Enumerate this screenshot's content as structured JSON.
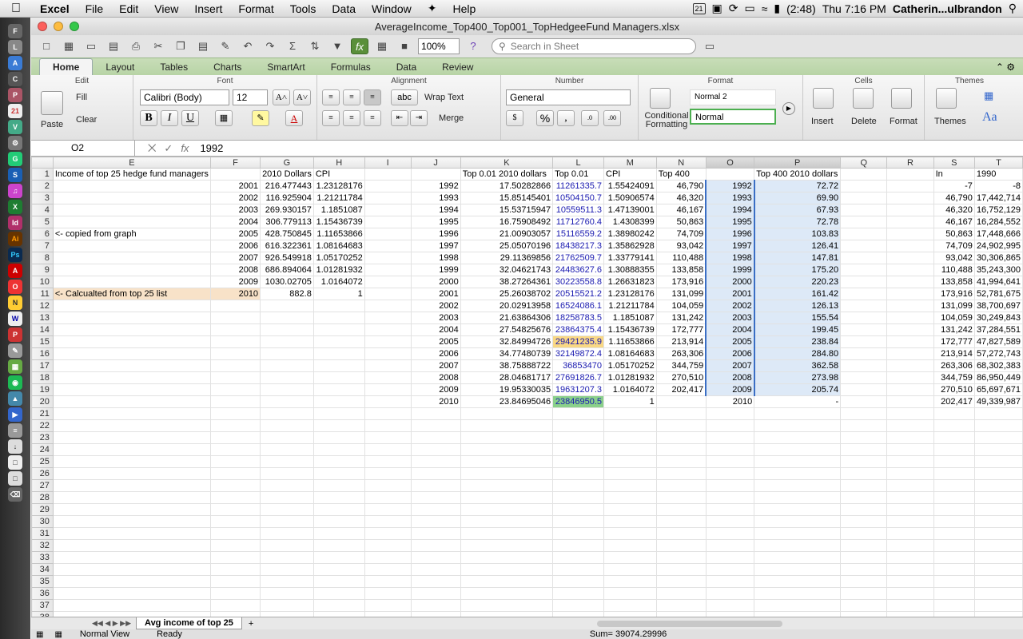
{
  "menubar": {
    "app": "Excel",
    "items": [
      "File",
      "Edit",
      "View",
      "Insert",
      "Format",
      "Tools",
      "Data",
      "Window",
      "Help"
    ],
    "battery": "(2:48)",
    "clock": "Thu 7:16 PM",
    "user": "Catherin...ulbrandon",
    "calendar_day": "21"
  },
  "window": {
    "title": "AverageIncome_Top400_Top001_TopHedgeeFund Managers.xlsx",
    "zoom": "100%",
    "search_placeholder": "Search in Sheet"
  },
  "ribbon": {
    "tabs": [
      "Home",
      "Layout",
      "Tables",
      "Charts",
      "SmartArt",
      "Formulas",
      "Data",
      "Review"
    ],
    "active_tab": "Home",
    "groups": {
      "edit": "Edit",
      "font": "Font",
      "alignment": "Alignment",
      "number": "Number",
      "format": "Format",
      "cells": "Cells",
      "themes": "Themes"
    },
    "edit": {
      "paste": "Paste",
      "fill": "Fill",
      "clear": "Clear"
    },
    "font": {
      "name": "Calibri (Body)",
      "size": "12",
      "bold": "B",
      "italic": "I",
      "underline": "U"
    },
    "alignment": {
      "wrap": "Wrap Text",
      "merge": "Merge",
      "orient": "abc"
    },
    "number": {
      "format": "General",
      "percent": "%",
      "comma": ","
    },
    "format": {
      "conditional": "Conditional Formatting",
      "style1": "Normal 2",
      "style2": "Normal"
    },
    "cells": {
      "insert": "Insert",
      "delete": "Delete",
      "format": "Format"
    },
    "themes": {
      "themes": "Themes",
      "aa": "Aa"
    }
  },
  "formula_bar": {
    "name_box": "O2",
    "fx": "fx",
    "value": "1992"
  },
  "sheet": {
    "columns": [
      "E",
      "F",
      "G",
      "H",
      "I",
      "J",
      "K",
      "L",
      "M",
      "N",
      "O",
      "P",
      "Q",
      "R",
      "S",
      "T"
    ],
    "selected_columns": [
      "O",
      "P"
    ],
    "rows": [
      [
        "Income of top 25 hedge fund managers",
        "",
        "2010 Dollars",
        "CPI",
        "",
        "",
        "Top  0.01 2010 dollars",
        "Top 0.01",
        "CPI",
        "Top 400",
        "",
        "Top 400 2010 dollars",
        "",
        "",
        "In",
        "1990"
      ],
      [
        "",
        "2001",
        "216.477443",
        "1.23128176",
        "",
        "1992",
        "17.50282866",
        "11261335.7",
        "1.55424091",
        "46,790",
        "1992",
        "72.72",
        "",
        "",
        "-7",
        "-8"
      ],
      [
        "",
        "2002",
        "116.925904",
        "1.21211784",
        "",
        "1993",
        "15.85145401",
        "10504150.7",
        "1.50906574",
        "46,320",
        "1993",
        "69.90",
        "",
        "",
        "46,790",
        "17,442,714"
      ],
      [
        "",
        "2003",
        "269.930157",
        "1.1851087",
        "",
        "1994",
        "15.53715947",
        "10559511.3",
        "1.47139001",
        "46,167",
        "1994",
        "67.93",
        "",
        "",
        "46,320",
        "16,752,129"
      ],
      [
        "",
        "2004",
        "306.779113",
        "1.15436739",
        "",
        "1995",
        "16.75908492",
        "11712760.4",
        "1.4308399",
        "50,863",
        "1995",
        "72.78",
        "",
        "",
        "46,167",
        "16,284,552"
      ],
      [
        "<- copied from graph",
        "2005",
        "428.750845",
        "1.11653866",
        "",
        "1996",
        "21.00903057",
        "15116559.2",
        "1.38980242",
        "74,709",
        "1996",
        "103.83",
        "",
        "",
        "50,863",
        "17,448,666"
      ],
      [
        "",
        "2006",
        "616.322361",
        "1.08164683",
        "",
        "1997",
        "25.05070196",
        "18438217.3",
        "1.35862928",
        "93,042",
        "1997",
        "126.41",
        "",
        "",
        "74,709",
        "24,902,995"
      ],
      [
        "",
        "2007",
        "926.549918",
        "1.05170252",
        "",
        "1998",
        "29.11369856",
        "21762509.7",
        "1.33779141",
        "110,488",
        "1998",
        "147.81",
        "",
        "",
        "93,042",
        "30,306,865"
      ],
      [
        "",
        "2008",
        "686.894064",
        "1.01281932",
        "",
        "1999",
        "32.04621743",
        "24483627.6",
        "1.30888355",
        "133,858",
        "1999",
        "175.20",
        "",
        "",
        "110,488",
        "35,243,300"
      ],
      [
        "",
        "2009",
        "1030.02705",
        "1.0164072",
        "",
        "2000",
        "38.27264361",
        "30223558.8",
        "1.26631823",
        "173,916",
        "2000",
        "220.23",
        "",
        "",
        "133,858",
        "41,994,641"
      ],
      [
        "<- Calcualted from top 25 list",
        "2010",
        "882.8",
        "1",
        "",
        "2001",
        "25.26038702",
        "20515521.2",
        "1.23128176",
        "131,099",
        "2001",
        "161.42",
        "",
        "",
        "173,916",
        "52,781,675"
      ],
      [
        "",
        "",
        "",
        "",
        "",
        "2002",
        "20.02913958",
        "16524086.1",
        "1.21211784",
        "104,059",
        "2002",
        "126.13",
        "",
        "",
        "131,099",
        "38,700,697"
      ],
      [
        "",
        "",
        "",
        "",
        "",
        "2003",
        "21.63864306",
        "18258783.5",
        "1.1851087",
        "131,242",
        "2003",
        "155.54",
        "",
        "",
        "104,059",
        "30,249,843"
      ],
      [
        "",
        "",
        "",
        "",
        "",
        "2004",
        "27.54825676",
        "23864375.4",
        "1.15436739",
        "172,777",
        "2004",
        "199.45",
        "",
        "",
        "131,242",
        "37,284,551"
      ],
      [
        "",
        "",
        "",
        "",
        "",
        "2005",
        "32.84994726",
        "29421235.9",
        "1.11653866",
        "213,914",
        "2005",
        "238.84",
        "",
        "",
        "172,777",
        "47,827,589"
      ],
      [
        "",
        "",
        "",
        "",
        "",
        "2006",
        "34.77480739",
        "32149872.4",
        "1.08164683",
        "263,306",
        "2006",
        "284.80",
        "",
        "",
        "213,914",
        "57,272,743"
      ],
      [
        "",
        "",
        "",
        "",
        "",
        "2007",
        "38.75888722",
        "36853470",
        "1.05170252",
        "344,759",
        "2007",
        "362.58",
        "",
        "",
        "263,306",
        "68,302,383"
      ],
      [
        "",
        "",
        "",
        "",
        "",
        "2008",
        "28.04681717",
        "27691826.7",
        "1.01281932",
        "270,510",
        "2008",
        "273.98",
        "",
        "",
        "344,759",
        "86,950,449"
      ],
      [
        "",
        "",
        "",
        "",
        "",
        "2009",
        "19.95330035",
        "19631207.3",
        "1.0164072",
        "202,417",
        "2009",
        "205.74",
        "",
        "",
        "270,510",
        "65,697,671"
      ],
      [
        "",
        "",
        "",
        "",
        "",
        "2010",
        "23.84695046",
        "23846950.5",
        "1",
        "",
        "2010",
        "-",
        "",
        "",
        "202,417",
        "49,339,987"
      ]
    ],
    "empty_rows_until": 38
  },
  "sheet_tabs": {
    "active": "Avg income of top 25",
    "add": "+"
  },
  "status": {
    "view": "Normal View",
    "state": "Ready",
    "sum": "Sum= 39074.29996"
  }
}
